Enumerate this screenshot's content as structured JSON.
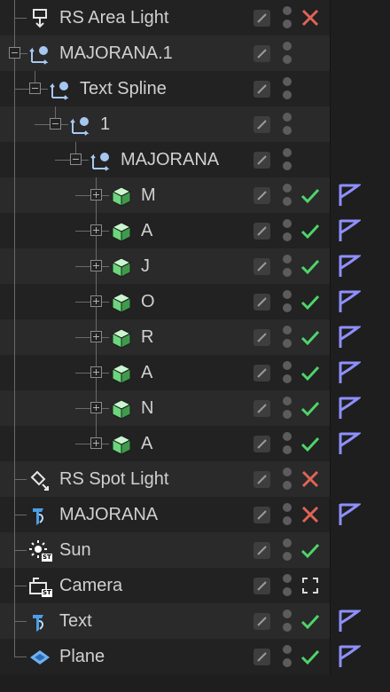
{
  "objects": [
    {
      "name": "RS Area Light",
      "depth": 0,
      "icon": "area-light-icon",
      "status": "disabled",
      "tag": false,
      "expander": "none"
    },
    {
      "name": "MAJORANA.1",
      "depth": 0,
      "icon": "spline-null-icon",
      "status": "none",
      "tag": false,
      "expander": "minus"
    },
    {
      "name": "Text Spline",
      "depth": 1,
      "icon": "spline-null-icon",
      "status": "none",
      "tag": false,
      "expander": "minus"
    },
    {
      "name": "1",
      "depth": 2,
      "icon": "spline-null-icon",
      "status": "none",
      "tag": false,
      "expander": "minus"
    },
    {
      "name": "MAJORANA",
      "depth": 3,
      "icon": "spline-null-icon",
      "status": "none",
      "tag": false,
      "expander": "minus"
    },
    {
      "name": "M",
      "depth": 4,
      "icon": "extrude-cube-icon",
      "status": "enabled",
      "tag": true,
      "expander": "plus"
    },
    {
      "name": "A",
      "depth": 4,
      "icon": "extrude-cube-icon",
      "status": "enabled",
      "tag": true,
      "expander": "plus"
    },
    {
      "name": "J",
      "depth": 4,
      "icon": "extrude-cube-icon",
      "status": "enabled",
      "tag": true,
      "expander": "plus"
    },
    {
      "name": "O",
      "depth": 4,
      "icon": "extrude-cube-icon",
      "status": "enabled",
      "tag": true,
      "expander": "plus"
    },
    {
      "name": "R",
      "depth": 4,
      "icon": "extrude-cube-icon",
      "status": "enabled",
      "tag": true,
      "expander": "plus"
    },
    {
      "name": "A",
      "depth": 4,
      "icon": "extrude-cube-icon",
      "status": "enabled",
      "tag": true,
      "expander": "plus"
    },
    {
      "name": "N",
      "depth": 4,
      "icon": "extrude-cube-icon",
      "status": "enabled",
      "tag": true,
      "expander": "plus"
    },
    {
      "name": "A",
      "depth": 4,
      "icon": "extrude-cube-icon",
      "status": "enabled",
      "tag": true,
      "expander": "plus"
    },
    {
      "name": "RS Spot Light",
      "depth": 0,
      "icon": "spot-light-icon",
      "status": "disabled",
      "tag": false,
      "expander": "none"
    },
    {
      "name": "MAJORANA",
      "depth": 0,
      "icon": "text-object-icon",
      "status": "disabled",
      "tag": true,
      "expander": "none"
    },
    {
      "name": "Sun",
      "depth": 0,
      "icon": "sun-icon",
      "status": "enabled",
      "tag": false,
      "expander": "none"
    },
    {
      "name": "Camera",
      "depth": 0,
      "icon": "camera-icon",
      "status": "camera-target",
      "tag": false,
      "expander": "none"
    },
    {
      "name": "Text",
      "depth": 0,
      "icon": "text-object-icon",
      "status": "enabled",
      "tag": true,
      "expander": "none"
    },
    {
      "name": "Plane",
      "depth": 0,
      "icon": "plane-icon",
      "status": "enabled",
      "tag": true,
      "expander": "none"
    }
  ],
  "icon_badges": {
    "sun-icon": "ST",
    "camera-icon": "ST"
  },
  "colors": {
    "check": "#4fd46a",
    "cross": "#e06456",
    "tag": "#8f8fff",
    "cube_green": "#6bd67a",
    "icon_blue": "#a6c8f0",
    "text_object_blue": "#4a9fe6"
  }
}
